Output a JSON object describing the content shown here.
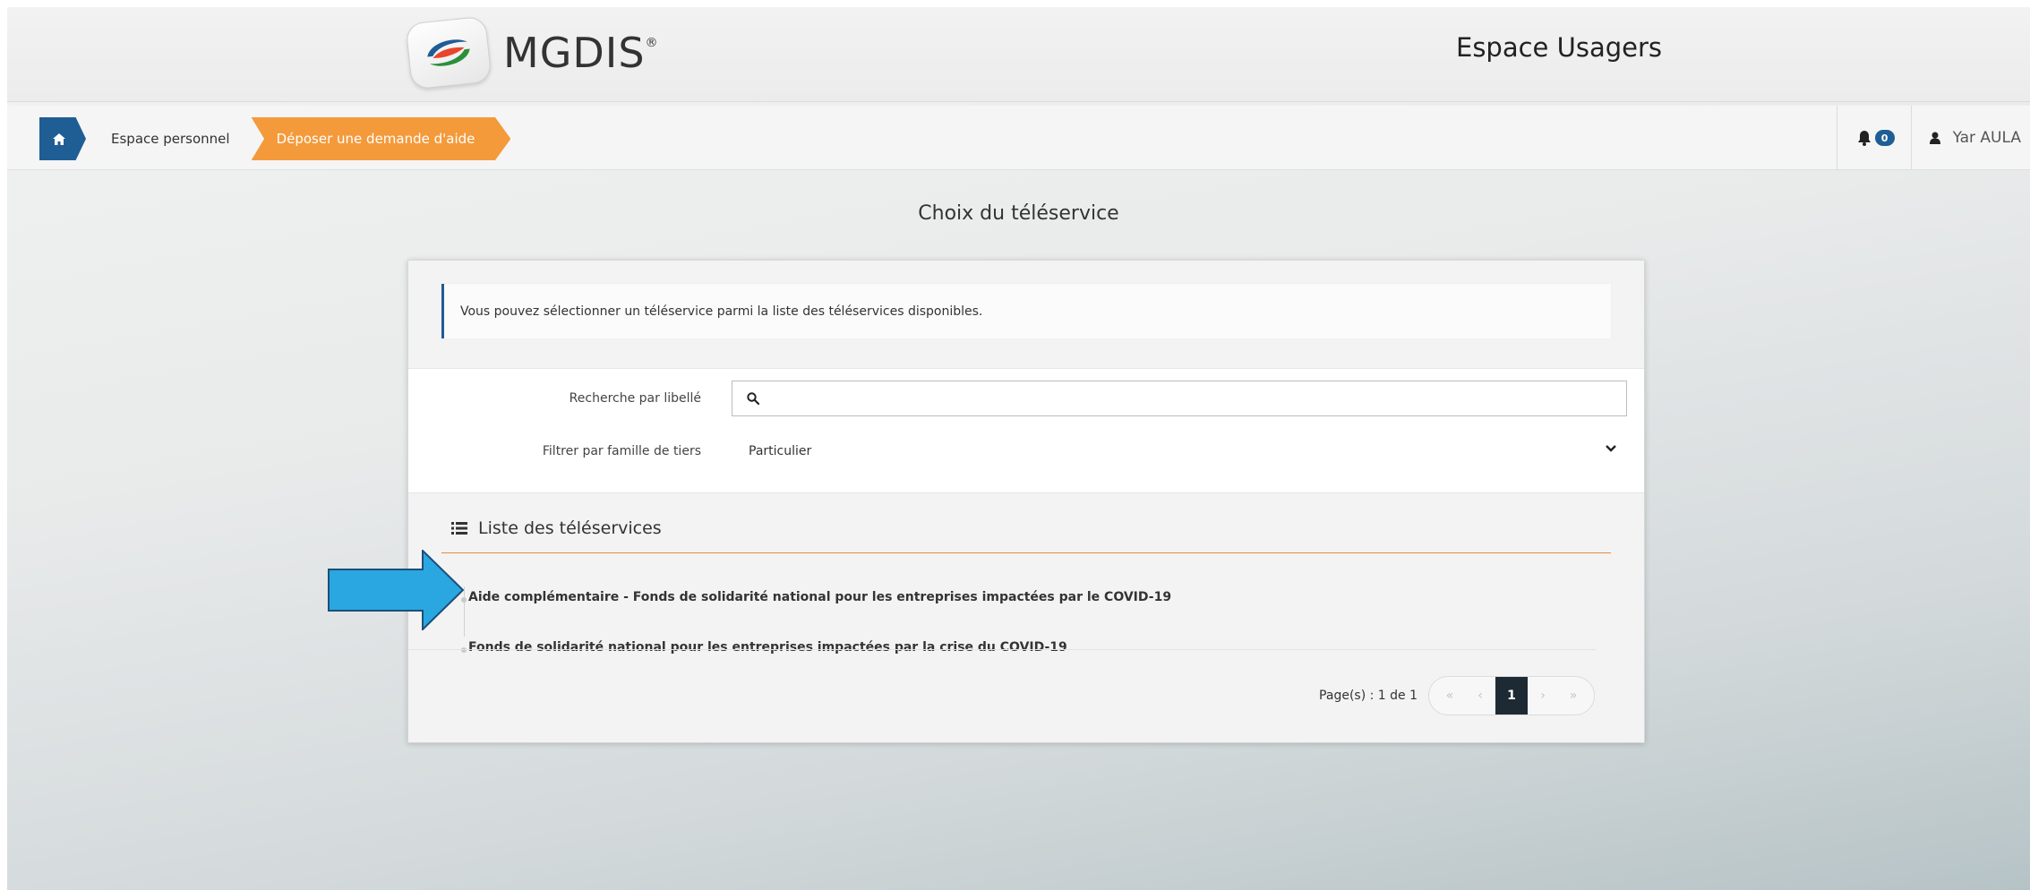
{
  "header": {
    "brand": "MGDIS",
    "brand_mark": "®",
    "space_title": "Espace Usagers"
  },
  "breadcrumb": {
    "home_icon": "home-icon",
    "items": [
      {
        "label": "Espace personnel"
      },
      {
        "label": "Déposer une demande d'aide"
      }
    ]
  },
  "user": {
    "notifications_count": "0",
    "name": "Yar AULA"
  },
  "page": {
    "title": "Choix du téléservice"
  },
  "info": {
    "text": "Vous pouvez sélectionner un téléservice parmi la liste des téléservices disponibles."
  },
  "filters": {
    "search_label": "Recherche par libellé",
    "search_value": "",
    "family_label": "Filtrer par famille de tiers",
    "family_value": "Particulier"
  },
  "list": {
    "title": "Liste des téléservices",
    "items": [
      "Aide complémentaire - Fonds de solidarité national pour les entreprises impactées par le COVID-19",
      "Fonds de solidarité national pour les entreprises impactées par la crise du COVID-19"
    ]
  },
  "pagination": {
    "label": "Page(s) : 1 de 1",
    "first": "«",
    "prev": "‹",
    "current": "1",
    "next": "›",
    "last": "»"
  },
  "colors": {
    "primary": "#1f5d95",
    "accent": "#f49a3b",
    "annotation_arrow": "#2aa7e0"
  }
}
